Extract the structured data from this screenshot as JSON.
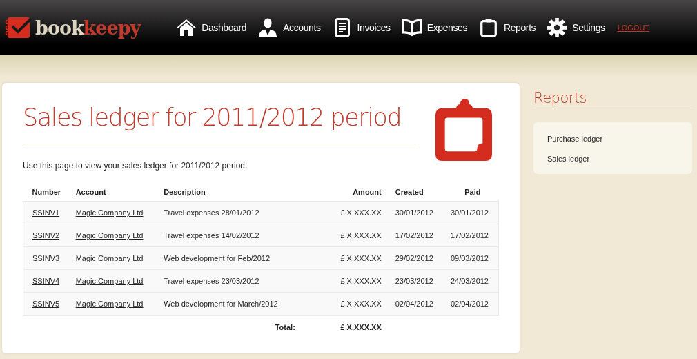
{
  "logo": {
    "first": "book",
    "second": "keepy"
  },
  "nav": [
    {
      "label": "Dashboard",
      "kind": "home"
    },
    {
      "label": "Accounts",
      "kind": "user"
    },
    {
      "label": "Invoices",
      "kind": "document"
    },
    {
      "label": "Expenses",
      "kind": "book"
    },
    {
      "label": "Reports",
      "kind": "clipboard"
    },
    {
      "label": "Settings",
      "kind": "gear"
    }
  ],
  "logout": "LOGOUT",
  "page": {
    "title": "Sales ledger for 2011/2012 period",
    "intro": "Use this page to view your sales ledger for 2011/2012 period."
  },
  "table": {
    "columns": [
      "Number",
      "Account",
      "Description",
      "Amount",
      "Created",
      "Paid"
    ],
    "rows": [
      [
        "SSINV1",
        "Magic Company Ltd",
        "Travel expenses 28/01/2012",
        "£ X,XXX.XX",
        "30/01/2012",
        "30/01/2012"
      ],
      [
        "SSINV2",
        "Magic Company Ltd",
        "Travel expenses 14/02/2012",
        "£ X,XXX.XX",
        "17/02/2012",
        "17/02/2012"
      ],
      [
        "SSINV3",
        "Magic Company Ltd",
        "Web development for Feb/2012",
        "£ X,XXX.XX",
        "29/02/2012",
        "09/03/2012"
      ],
      [
        "SSINV4",
        "Magic Company Ltd",
        "Travel expenses 23/03/2012",
        "£ X,XXX.XX",
        "23/03/2012",
        "24/03/2012"
      ],
      [
        "SSINV5",
        "Magic Company Ltd",
        "Web development for March/2012",
        "£ X,XXX.XX",
        "02/04/2012",
        "02/04/2012"
      ]
    ],
    "total_label": "Total:",
    "total": "£ X,XXX.XX"
  },
  "sidebar": {
    "title": "Reports",
    "items": [
      "Purchase ledger",
      "Sales ledger"
    ]
  }
}
